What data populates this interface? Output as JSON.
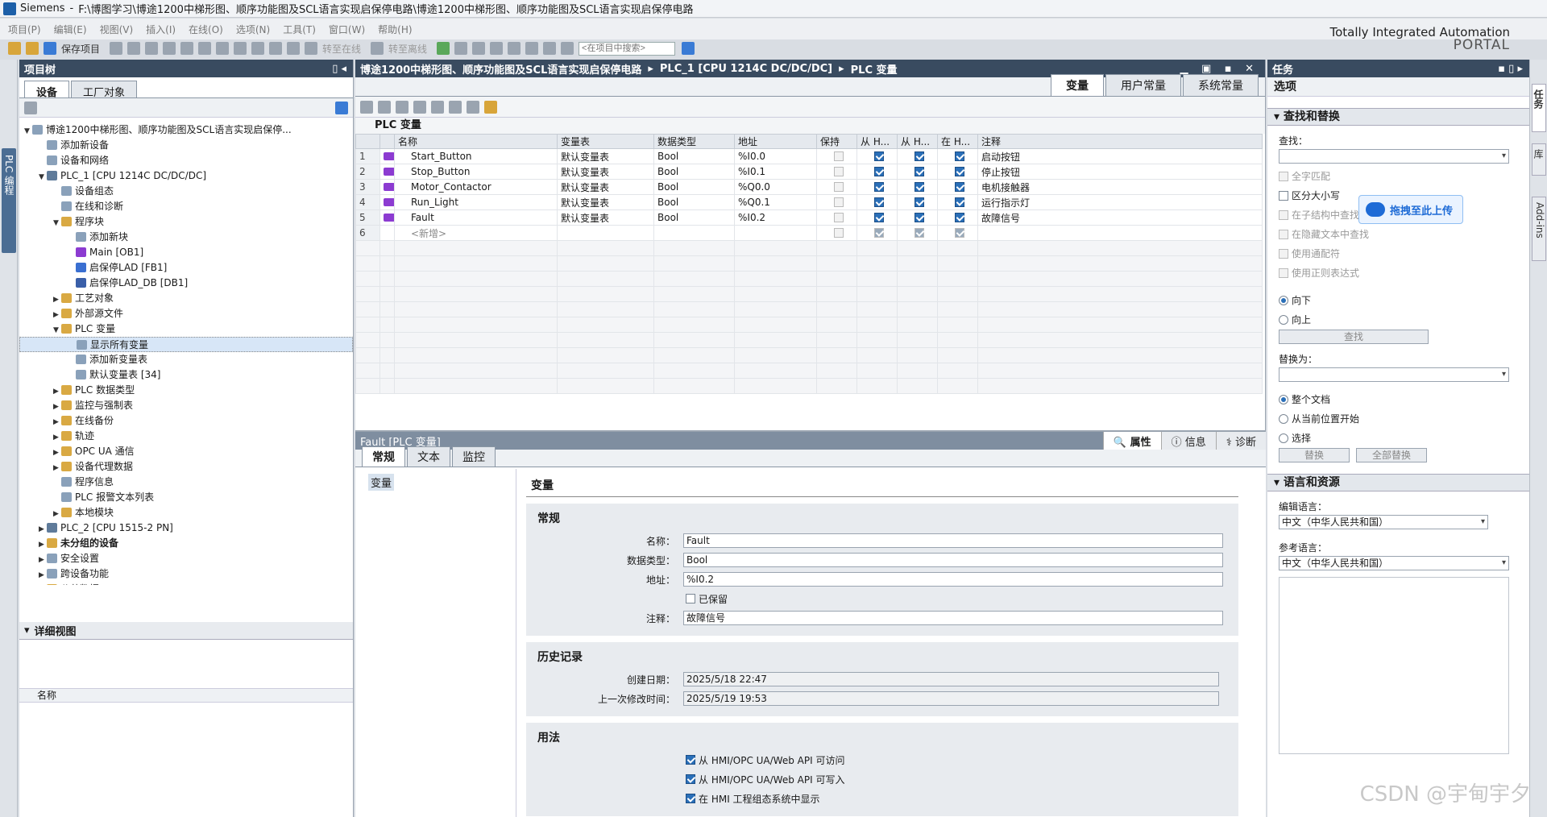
{
  "window": {
    "app": "Siemens",
    "path": "F:\\博图学习\\博途1200中梯形图、顺序功能图及SCL语言实现启保停电路\\博途1200中梯形图、顺序功能图及SCL语言实现启保停电路"
  },
  "menu": [
    "项目(P)",
    "编辑(E)",
    "视图(V)",
    "插入(I)",
    "在线(O)",
    "选项(N)",
    "工具(T)",
    "窗口(W)",
    "帮助(H)"
  ],
  "brand": {
    "line1": "Totally Integrated Automation",
    "line2": "PORTAL"
  },
  "toolbar": {
    "save": "保存项目",
    "go_online": "转至在线",
    "go_offline": "转至离线",
    "search_placeholder": "<在项目中搜索>"
  },
  "left_vtab": "PLC 编程",
  "project_tree": {
    "title": "项目树",
    "tabs": [
      "设备",
      "工厂对象"
    ],
    "items": [
      {
        "label": "博途1200中梯形图、顺序功能图及SCL语言实现启保停...",
        "level": 0,
        "icon": "project-icon",
        "expanded": true
      },
      {
        "label": "添加新设备",
        "level": 1,
        "icon": "add-device-icon"
      },
      {
        "label": "设备和网络",
        "level": 1,
        "icon": "network-icon"
      },
      {
        "label": "PLC_1 [CPU 1214C DC/DC/DC]",
        "level": 1,
        "icon": "cpu-icon",
        "expanded": true
      },
      {
        "label": "设备组态",
        "level": 2,
        "icon": "device-config-icon"
      },
      {
        "label": "在线和诊断",
        "level": 2,
        "icon": "diagnostics-icon"
      },
      {
        "label": "程序块",
        "level": 2,
        "icon": "folder-icon",
        "expanded": true
      },
      {
        "label": "添加新块",
        "level": 3,
        "icon": "add-block-icon"
      },
      {
        "label": "Main [OB1]",
        "level": 3,
        "icon": "ob-icon"
      },
      {
        "label": "启保停LAD [FB1]",
        "level": 3,
        "icon": "fb-icon"
      },
      {
        "label": "启保停LAD_DB [DB1]",
        "level": 3,
        "icon": "db-icon"
      },
      {
        "label": "工艺对象",
        "level": 2,
        "icon": "folder-icon",
        "collapsed": true
      },
      {
        "label": "外部源文件",
        "level": 2,
        "icon": "folder-icon",
        "collapsed": true
      },
      {
        "label": "PLC 变量",
        "level": 2,
        "icon": "folder-icon",
        "expanded": true
      },
      {
        "label": "显示所有变量",
        "level": 3,
        "icon": "show-tags-icon",
        "selected": true
      },
      {
        "label": "添加新变量表",
        "level": 3,
        "icon": "add-tag-table-icon"
      },
      {
        "label": "默认变量表 [34]",
        "level": 3,
        "icon": "tag-table-icon"
      },
      {
        "label": "PLC 数据类型",
        "level": 2,
        "icon": "folder-icon",
        "collapsed": true
      },
      {
        "label": "监控与强制表",
        "level": 2,
        "icon": "folder-icon",
        "collapsed": true
      },
      {
        "label": "在线备份",
        "level": 2,
        "icon": "folder-icon",
        "collapsed": true
      },
      {
        "label": "轨迹",
        "level": 2,
        "icon": "folder-icon",
        "collapsed": true
      },
      {
        "label": "OPC UA 通信",
        "level": 2,
        "icon": "folder-icon",
        "collapsed": true
      },
      {
        "label": "设备代理数据",
        "level": 2,
        "icon": "folder-icon",
        "collapsed": true
      },
      {
        "label": "程序信息",
        "level": 2,
        "icon": "program-info-icon"
      },
      {
        "label": "PLC 报警文本列表",
        "level": 2,
        "icon": "alarm-list-icon"
      },
      {
        "label": "本地模块",
        "level": 2,
        "icon": "folder-icon",
        "collapsed": true
      },
      {
        "label": "PLC_2 [CPU 1515-2 PN]",
        "level": 1,
        "icon": "cpu-icon",
        "collapsed": true
      },
      {
        "label": "未分组的设备",
        "level": 1,
        "icon": "folder-icon",
        "collapsed": true,
        "bold": true
      },
      {
        "label": "安全设置",
        "level": 1,
        "icon": "security-icon",
        "collapsed": true
      },
      {
        "label": "跨设备功能",
        "level": 1,
        "icon": "cross-device-icon",
        "collapsed": true
      },
      {
        "label": "公共数据",
        "level": 1,
        "icon": "folder-icon",
        "collapsed": true
      }
    ]
  },
  "detail_view": {
    "title": "详细视图",
    "column": "名称"
  },
  "editor": {
    "breadcrumb": [
      "博途1200中梯形图、顺序功能图及SCL语言实现启保停电路",
      "PLC_1 [CPU 1214C DC/DC/DC]",
      "PLC 变量"
    ],
    "view_tabs": [
      "变量",
      "用户常量",
      "系统常量"
    ],
    "table_title": "PLC 变量",
    "columns": [
      "",
      "",
      "名称",
      "变量表",
      "数据类型",
      "地址",
      "保持",
      "从 H...",
      "从 H...",
      "在 H...",
      "注释"
    ],
    "rows": [
      {
        "num": "1",
        "name": "Start_Button",
        "table": "默认变量表",
        "type": "Bool",
        "addr": "%I0.0",
        "retain": false,
        "h1": true,
        "h2": true,
        "h3": true,
        "comment": "启动按钮"
      },
      {
        "num": "2",
        "name": "Stop_Button",
        "table": "默认变量表",
        "type": "Bool",
        "addr": "%I0.1",
        "retain": false,
        "h1": true,
        "h2": true,
        "h3": true,
        "comment": "停止按钮"
      },
      {
        "num": "3",
        "name": "Motor_Contactor",
        "table": "默认变量表",
        "type": "Bool",
        "addr": "%Q0.0",
        "retain": false,
        "h1": true,
        "h2": true,
        "h3": true,
        "comment": "电机接触器"
      },
      {
        "num": "4",
        "name": "Run_Light",
        "table": "默认变量表",
        "type": "Bool",
        "addr": "%Q0.1",
        "retain": false,
        "h1": true,
        "h2": true,
        "h3": true,
        "comment": "运行指示灯"
      },
      {
        "num": "5",
        "name": "Fault",
        "table": "默认变量表",
        "type": "Bool",
        "addr": "%I0.2",
        "retain": false,
        "h1": true,
        "h2": true,
        "h3": true,
        "comment": "故障信号"
      },
      {
        "num": "6",
        "name": "<新增>",
        "table": "",
        "type": "",
        "addr": "",
        "retain": false,
        "h1": true,
        "h2": true,
        "h3": true,
        "comment": "",
        "placeholder": true
      }
    ]
  },
  "properties": {
    "title": "Fault [PLC 变量]",
    "tabs": [
      "属性",
      "信息",
      "诊断"
    ],
    "subtabs": [
      "常规",
      "文本",
      "监控"
    ],
    "nav_item": "变量",
    "section": "变量",
    "general": {
      "title": "常规",
      "name_label": "名称：",
      "name": "Fault",
      "type_label": "数据类型：",
      "type": "Bool",
      "addr_label": "地址：",
      "addr": "%I0.2",
      "retain_label": "已保留",
      "comment_label": "注释：",
      "comment": "故障信号"
    },
    "history": {
      "title": "历史记录",
      "created_label": "创建日期：",
      "created": "2025/5/18 22:47",
      "modified_label": "上一次修改时间：",
      "modified": "2025/5/19 19:53"
    },
    "usage": {
      "title": "用法",
      "items": [
        "从 HMI/OPC UA/Web API 可访问",
        "从 HMI/OPC UA/Web API 可写入",
        "在 HMI 工程组态系统中显示"
      ]
    }
  },
  "tasks": {
    "title": "任务",
    "options": "选项",
    "find_replace": "查找和替换",
    "find_label": "查找：",
    "options_list": [
      "全字匹配",
      "区分大小写",
      "在子结构中查找",
      "在隐藏文本中查找",
      "使用通配符",
      "使用正则表达式"
    ],
    "dir_down": "向下",
    "dir_up": "向上",
    "find_button": "查找",
    "replace_label": "替换为：",
    "scope": [
      "整个文档",
      "从当前位置开始",
      "选择"
    ],
    "replace_button": "替换",
    "replace_all_button": "全部替换",
    "lang_section": "语言和资源",
    "edit_lang_label": "编辑语言：",
    "edit_lang": "中文（中华人民共和国）",
    "ref_lang_label": "参考语言：",
    "ref_lang": "中文（中华人民共和国）",
    "upload": "拖拽至此上传"
  },
  "right_vtabs": [
    "任务",
    "库",
    "Add-ins"
  ],
  "watermark": "CSDN @宇甸宇夕"
}
